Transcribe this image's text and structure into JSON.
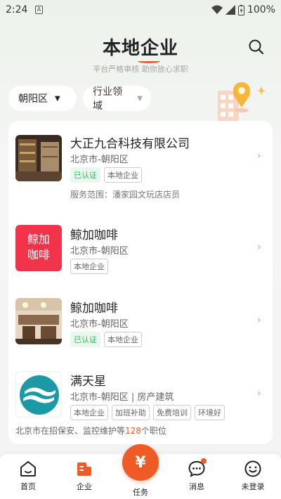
{
  "status": {
    "time": "2:24",
    "notif_glyph": "A",
    "battery": "100%"
  },
  "header": {
    "title": "本地企业",
    "subtitle": "平台严格审核 助你放心求职"
  },
  "filters": [
    {
      "label": "朝阳区"
    },
    {
      "label": "行业领域"
    }
  ],
  "companies": [
    {
      "name": "大正九合科技有限公司",
      "location": "北京市-朝阳区",
      "tags": [
        "已认证",
        "本地企业"
      ],
      "service": "服务范围：潘家园文玩店店员"
    },
    {
      "name": "鲸加咖啡",
      "logo_text": [
        "鲸加",
        "咖啡"
      ],
      "location": "北京市-朝阳区",
      "tags": [
        "本地企业"
      ]
    },
    {
      "name": "鲸加咖啡",
      "location": "北京市-朝阳区",
      "tags": [
        "已认证",
        "本地企业"
      ]
    },
    {
      "name": "满天星",
      "location": "北京市-朝阳区 | 房产建筑",
      "tags": [
        "本地企业",
        "加班补助",
        "免费培训",
        "环境好"
      ],
      "hire_prefix": "北京市在招保安、监控维护等",
      "hire_count": "128",
      "hire_suffix": "个职位"
    }
  ],
  "tabbar": {
    "home": "首页",
    "company": "企业",
    "task_symbol": "¥",
    "task": "任务",
    "messages": "消息",
    "profile": "未登录"
  },
  "colors": {
    "accent": "#f05a24",
    "green": "#2fba5f"
  }
}
